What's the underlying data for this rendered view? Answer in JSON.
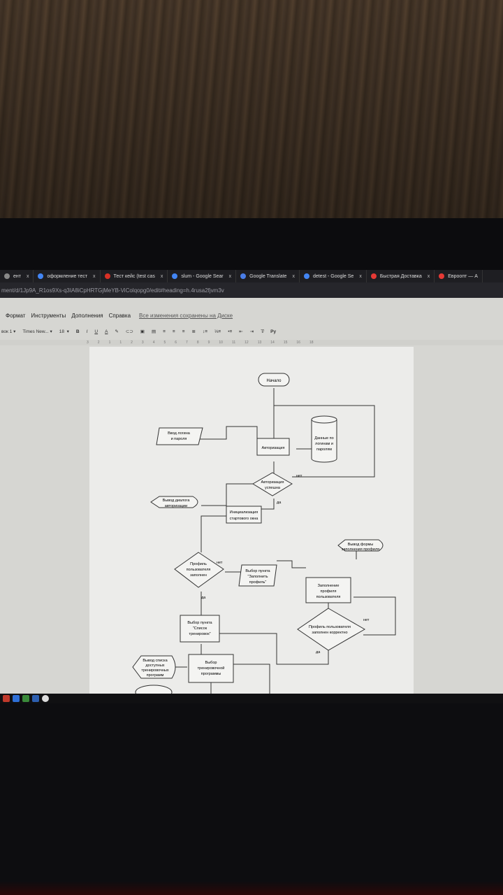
{
  "browser": {
    "tabs": [
      {
        "label": "ент",
        "icon": "partial-icon",
        "color": "#888888"
      },
      {
        "label": "оформление тест",
        "icon": "google-icon",
        "color": "#4285f4"
      },
      {
        "label": "Тест кейс (test cas",
        "icon": "red-u-icon",
        "color": "#d93025"
      },
      {
        "label": "slum - Google Sear",
        "icon": "google-icon",
        "color": "#4285f4"
      },
      {
        "label": "Google Translate",
        "icon": "translate-icon",
        "color": "#4a7ee8"
      },
      {
        "label": "detest - Google Se",
        "icon": "google-icon",
        "color": "#4285f4"
      },
      {
        "label": "Быстрая Доставка",
        "icon": "delivery-icon",
        "color": "#e53935"
      },
      {
        "label": "Евроопт — А",
        "icon": "evroopt-icon",
        "color": "#e53935"
      }
    ],
    "close_glyph": "x",
    "url": "ment/d/1Jp9A_R1os9Xs-q3IA8iCpHRTGjMeYB-ViColqopg0/edit#heading=h.4rusa2fjvm3v"
  },
  "docs": {
    "menu": [
      "Формат",
      "Инструменты",
      "Дополнения",
      "Справка"
    ],
    "saved_status": "Все изменения сохранены на Диске",
    "toolbar": {
      "style": "вок 1",
      "font": "Times New...",
      "size": "18",
      "bold": "B",
      "italic": "I",
      "underline": "U",
      "text_color": "A",
      "input_tools": "Ру"
    },
    "ruler": [
      "3",
      "2",
      "1",
      "1",
      "2",
      "3",
      "4",
      "5",
      "6",
      "7",
      "8",
      "9",
      "10",
      "11",
      "12",
      "13",
      "14",
      "15",
      "16",
      "18"
    ]
  },
  "flowchart": {
    "start": "Начало",
    "login_input": [
      "Ввод логина",
      "и пароля"
    ],
    "authorization": "Авторизация",
    "db": [
      "Данные по",
      "логинам и",
      "паролям"
    ],
    "auth_dialog": [
      "Вывод диалога",
      "авторизации"
    ],
    "auth_ok": [
      "Авторизация",
      "успешна"
    ],
    "no1": "нет",
    "yes1": "да",
    "init": [
      "Инициализация",
      "стартового окна"
    ],
    "profile_filled": [
      "Профиль",
      "пользователя",
      "заполнен"
    ],
    "no2": "нет",
    "select_fill": [
      "Выбор пункта",
      "\"Заполнить",
      "профиль\""
    ],
    "profile_form": [
      "Вывод формы",
      "заполнения профиля"
    ],
    "fill_profile": [
      "Заполнение",
      "профиля",
      "пользователя"
    ],
    "yes2": "да",
    "select_list": [
      "Выбор пункта",
      "\"Список",
      "тренировок\""
    ],
    "profile_correct": [
      "Профиль пользователя",
      "заполнен корректно"
    ],
    "no3": "нет",
    "yes3": "да",
    "list_output": [
      "Вывод списка",
      "доступных",
      "тренировочных",
      "программ"
    ],
    "select_program": [
      "Выбор",
      "тренировочной",
      "программы"
    ]
  }
}
